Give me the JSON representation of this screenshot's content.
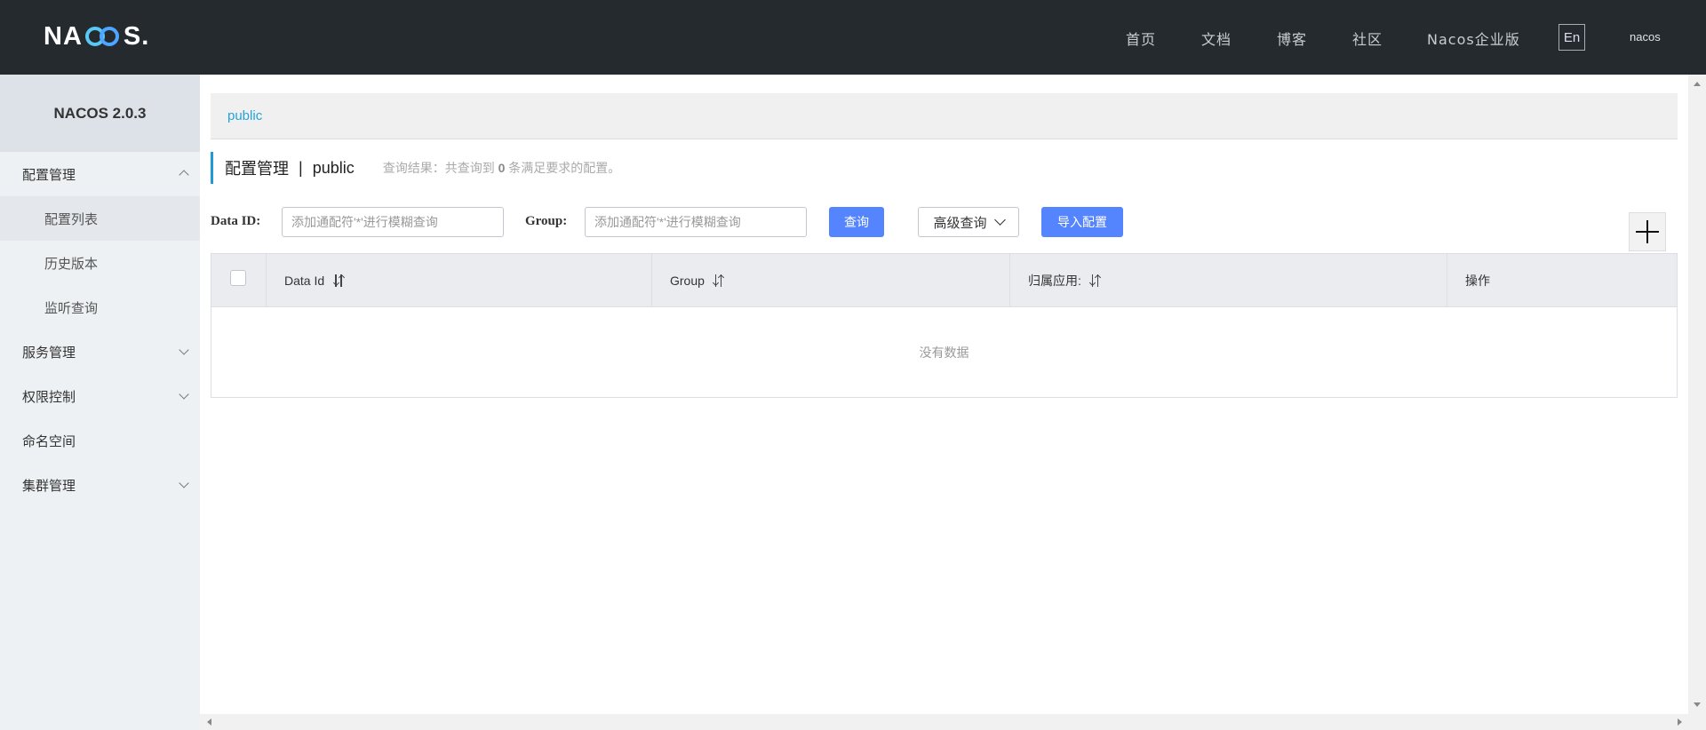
{
  "header": {
    "logo_left": "NA",
    "logo_right": "S.",
    "nav": [
      "首页",
      "文档",
      "博客",
      "社区",
      "Nacos企业版"
    ],
    "lang_button": "En",
    "user": "nacos"
  },
  "sidebar": {
    "title": "NACOS 2.0.3",
    "items": [
      {
        "label": "配置管理",
        "expanded": true
      },
      {
        "label": "配置列表",
        "sub": true,
        "active": true
      },
      {
        "label": "历史版本",
        "sub": true
      },
      {
        "label": "监听查询",
        "sub": true
      },
      {
        "label": "服务管理",
        "expanded": false
      },
      {
        "label": "权限控制",
        "expanded": false
      },
      {
        "label": "命名空间"
      },
      {
        "label": "集群管理",
        "expanded": false
      }
    ]
  },
  "namespace_bar": {
    "current": "public"
  },
  "page": {
    "title": "配置管理",
    "separator": "|",
    "namespace": "public",
    "result_prefix": "查询结果：共查询到",
    "result_count": "0",
    "result_suffix": "条满足要求的配置。"
  },
  "filters": {
    "data_id_label": "Data ID:",
    "data_id_placeholder": "添加通配符'*'进行模糊查询",
    "group_label": "Group:",
    "group_placeholder": "添加通配符'*'进行模糊查询",
    "search_button": "查询",
    "advanced_button": "高级查询",
    "import_button": "导入配置"
  },
  "table": {
    "columns": [
      "Data Id",
      "Group",
      "归属应用:",
      "操作"
    ],
    "empty_text": "没有数据"
  },
  "colors": {
    "header_bg": "#252a2f",
    "primary": "#5584ff",
    "link": "#23a3d8",
    "sidebar_bg": "#eef1f4"
  }
}
